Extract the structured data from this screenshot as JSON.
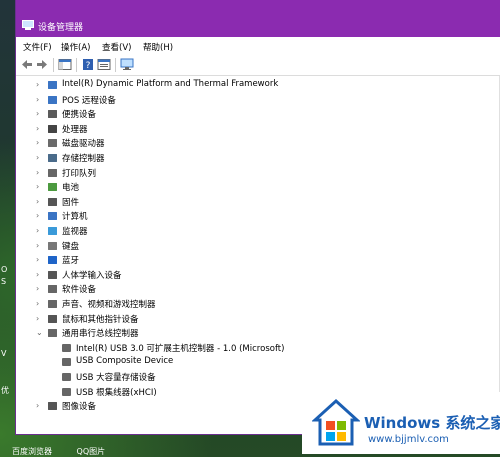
{
  "window": {
    "title": "设备管理器"
  },
  "menu": [
    "文件(F)",
    "操作(A)",
    "查看(V)",
    "帮助(H)"
  ],
  "tree": [
    {
      "label": "Intel(R) Dynamic Platform and Thermal Framework",
      "expanded": false
    },
    {
      "label": "POS 远程设备",
      "expanded": false
    },
    {
      "label": "便携设备",
      "expanded": false
    },
    {
      "label": "处理器",
      "expanded": false
    },
    {
      "label": "磁盘驱动器",
      "expanded": false
    },
    {
      "label": "存储控制器",
      "expanded": false
    },
    {
      "label": "打印队列",
      "expanded": false
    },
    {
      "label": "电池",
      "expanded": false
    },
    {
      "label": "固件",
      "expanded": false
    },
    {
      "label": "计算机",
      "expanded": false
    },
    {
      "label": "监视器",
      "expanded": false
    },
    {
      "label": "键盘",
      "expanded": false
    },
    {
      "label": "蓝牙",
      "expanded": false
    },
    {
      "label": "人体学输入设备",
      "expanded": false
    },
    {
      "label": "软件设备",
      "expanded": false
    },
    {
      "label": "声音、视频和游戏控制器",
      "expanded": false
    },
    {
      "label": "鼠标和其他指针设备",
      "expanded": false
    },
    {
      "label": "通用串行总线控制器",
      "expanded": true
    },
    {
      "label": "Intel(R) USB 3.0 可扩展主机控制器 - 1.0 (Microsoft)",
      "child": true
    },
    {
      "label": "USB Composite Device",
      "child": true
    },
    {
      "label": "USB 大容量存储设备",
      "child": true
    },
    {
      "label": "USB 根集线器(xHCI)",
      "child": true
    },
    {
      "label": "图像设备",
      "expanded": false
    }
  ],
  "desktop": {
    "left_labels": [
      "O",
      "S",
      "V",
      "优"
    ],
    "taskbar_labels": [
      "百度浏览器",
      "QQ图片"
    ]
  },
  "watermark": {
    "brand": "Windows 系统之家",
    "url": "www.bjjmlv.com"
  }
}
